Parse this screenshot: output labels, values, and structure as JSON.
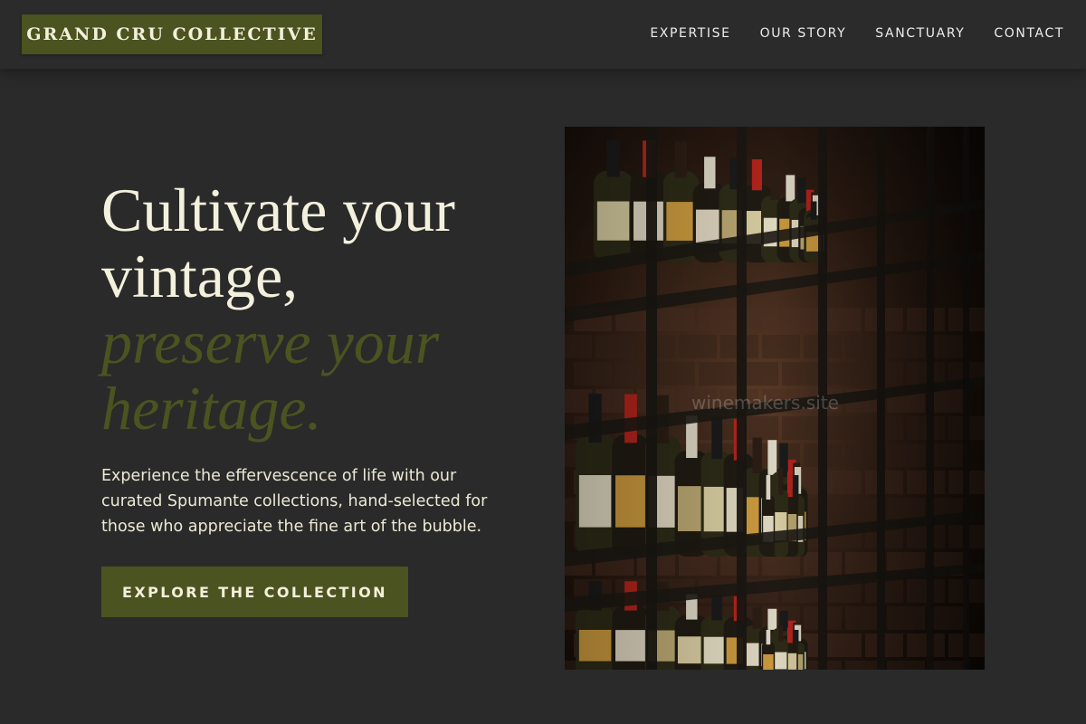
{
  "brand": {
    "name": "GRAND CRU COLLECTIVE",
    "accent_color": "#4b5320"
  },
  "nav": {
    "items": [
      {
        "label": "EXPERTISE"
      },
      {
        "label": "OUR STORY"
      },
      {
        "label": "SANCTUARY"
      },
      {
        "label": "CONTACT"
      }
    ]
  },
  "hero": {
    "headline_line1": "Cultivate your vintage,",
    "headline_line2": "preserve your heritage.",
    "body": "Experience the effervescence of life with our curated Spumante collections, hand-selected for those who appreciate the fine art of the bubble.",
    "cta_label": "EXPLORE THE COLLECTION"
  },
  "image": {
    "subject": "wine bottles on cellar shelves",
    "watermark": "winemakers.site"
  },
  "colors": {
    "background": "#2a2a2a",
    "text": "#f3f0dc",
    "accent": "#4b5320"
  }
}
